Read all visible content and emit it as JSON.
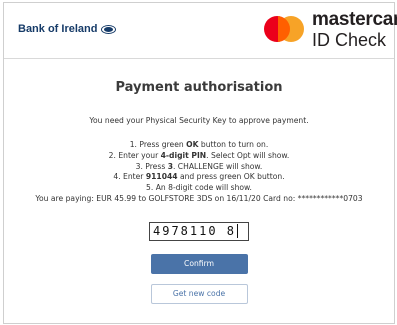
{
  "header": {
    "bank_name": "Bank of Ireland",
    "brand_word": "mastercard",
    "brand_sub": "ID Check",
    "colors": {
      "mc_red": "#eb001b",
      "mc_yellow": "#f79e1b",
      "bank_blue": "#163b68"
    }
  },
  "main": {
    "title": "Payment authorisation",
    "intro": "You need your Physical Security Key to approve payment.",
    "steps": [
      {
        "pre": "1. Press green ",
        "bold": "OK",
        "post": " button to turn on."
      },
      {
        "pre": "2. Enter your ",
        "bold": "4-digit PIN",
        "post": ". Select Opt will show."
      },
      {
        "pre": "3. Press ",
        "bold": "3",
        "post": ". CHALLENGE will show."
      },
      {
        "pre": "4. Enter ",
        "bold": "911044",
        "post": " and press green OK button."
      },
      {
        "pre": "5. An 8-digit code will show.",
        "bold": "",
        "post": ""
      }
    ],
    "paying": "You are paying: EUR 45.99 to GOLFSTORE 3DS on 16/11/20 Card no: ************0703"
  },
  "form": {
    "code_value": "4978110 8",
    "confirm_label": "Confirm",
    "new_code_label": "Get new code",
    "accent": "#4a73a8"
  }
}
